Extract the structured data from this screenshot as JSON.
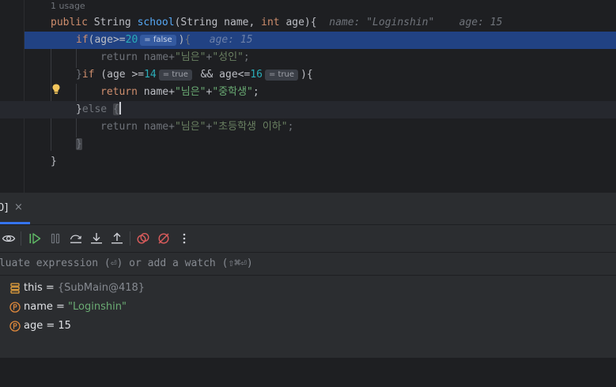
{
  "editor": {
    "usage": "1 usage",
    "method_line": {
      "kw_public": "public",
      "type": "String",
      "name": "school",
      "params_open": "(String name, ",
      "kw_int": "int",
      "params_close": " age){",
      "inline_name": "name: \"Loginshin\"",
      "inline_age": "age: 15"
    },
    "if_line": {
      "kw": "if",
      "cond": "(age>=",
      "num": "20",
      "hint": "= false",
      "close": ")",
      "brace": "{",
      "inline": "age: 15"
    },
    "return1": {
      "kw": "return",
      "a": " name+",
      "s1": "\"님은\"",
      "plus": "+",
      "s2": "\"성인\"",
      "end": ";"
    },
    "elseif_line": {
      "brace": "}",
      "kw": "if",
      "a": " (age >=",
      "num1": "14",
      "hint1": "= true",
      "and": " && age<=",
      "num2": "16",
      "hint2": "= true",
      "close": "){"
    },
    "return2": {
      "kw": "return",
      "a": " name+",
      "s1": "\"님은\"",
      "plus": "+",
      "s2": "\"중학생\"",
      "end": ";"
    },
    "else_line": {
      "brace": "}",
      "kw": "else",
      "open": "{"
    },
    "return3": {
      "kw": "return",
      "a": " name+",
      "s1": "\"님은\"",
      "plus": "+",
      "s2": "\"초등학생 이하\"",
      "end": ";"
    },
    "close_inner": "}",
    "close_method": "}"
  },
  "debug": {
    "tab_label": "0]",
    "tab_close": "×",
    "toolbar_icons": [
      "show-watches-icon",
      "resume-icon",
      "pause-icon",
      "step-over-icon",
      "step-into-icon",
      "step-out-icon",
      "view-breakpoints-icon",
      "mute-breakpoints-icon",
      "more-icon"
    ],
    "evaluate_placeholder": "aluate expression (⏎) or add a watch (⇧⌘⏎)",
    "variables": [
      {
        "icon": "field-icon",
        "name": "this",
        "eq": " = ",
        "value": "{SubMain@418}",
        "kind": "object"
      },
      {
        "icon": "parameter-icon",
        "name": "name",
        "eq": " = ",
        "value": "\"Loginshin\"",
        "kind": "string"
      },
      {
        "icon": "parameter-icon",
        "name": "age",
        "eq": " = ",
        "value": "15",
        "kind": "number"
      }
    ]
  },
  "colors": {
    "keyword": "#cf8e6d",
    "method": "#56a8f5",
    "string": "#6aab73",
    "number": "#2aacb8",
    "exec_line": "#214283",
    "accent": "#3574f0"
  }
}
